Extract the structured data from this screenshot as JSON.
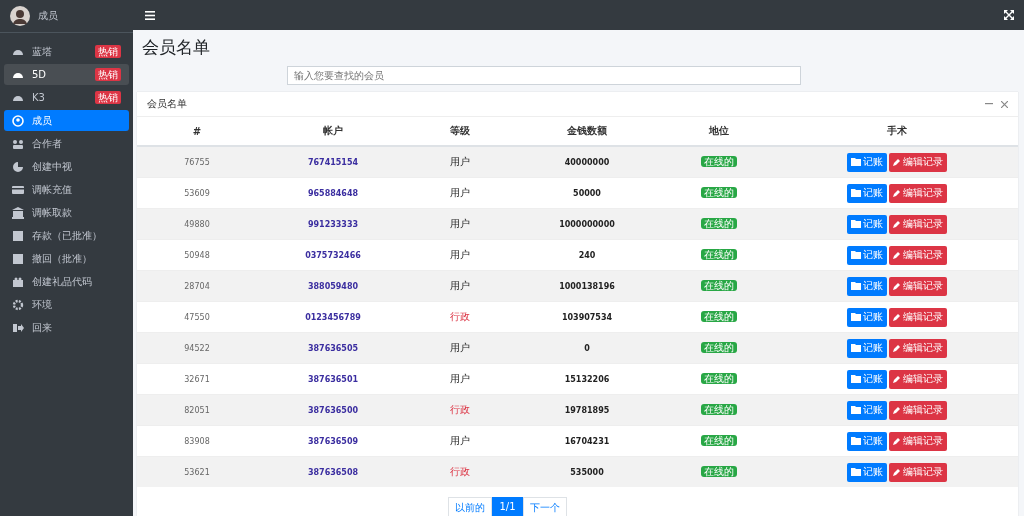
{
  "user": {
    "name": "成员"
  },
  "sidebar": {
    "items": [
      {
        "label": "蓝塔",
        "badge": "热销",
        "selected": false,
        "hover": false
      },
      {
        "label": "5D",
        "badge": "热销",
        "selected": false,
        "hover": true
      },
      {
        "label": "K3",
        "badge": "热销",
        "selected": false,
        "hover": false
      },
      {
        "label": "成员",
        "selected": true,
        "hover": false
      },
      {
        "label": "合作者",
        "selected": false,
        "hover": false
      },
      {
        "label": "创建中视",
        "selected": false,
        "hover": false
      },
      {
        "label": "调帐充值",
        "selected": false,
        "hover": false
      },
      {
        "label": "调帐取款",
        "selected": false,
        "hover": false
      },
      {
        "label": "存款（已批准）",
        "selected": false,
        "hover": false
      },
      {
        "label": "撤回（批准）",
        "selected": false,
        "hover": false
      },
      {
        "label": "创建礼品代码",
        "selected": false,
        "hover": false
      },
      {
        "label": "环境",
        "selected": false,
        "hover": false
      },
      {
        "label": "回来",
        "selected": false,
        "hover": false
      }
    ]
  },
  "page_title": "会员名单",
  "search": {
    "placeholder": "输入您要查找的会员"
  },
  "card": {
    "title": "会员名单",
    "columns": [
      "#",
      "帐户",
      "等级",
      "金钱数额",
      "地位",
      "手术"
    ],
    "rows": [
      {
        "id": "76755",
        "account": "767415154",
        "level": "用户",
        "kind": "user",
        "money": "40000000",
        "status": "在线的",
        "actions": [
          "记账",
          "编辑记录"
        ]
      },
      {
        "id": "53609",
        "account": "965884648",
        "level": "用户",
        "kind": "user",
        "money": "50000",
        "status": "在线的",
        "actions": [
          "记账",
          "编辑记录"
        ]
      },
      {
        "id": "49880",
        "account": "991233333",
        "level": "用户",
        "kind": "user",
        "money": "1000000000",
        "status": "在线的",
        "actions": [
          "记账",
          "编辑记录"
        ]
      },
      {
        "id": "50948",
        "account": "0375732466",
        "level": "用户",
        "kind": "user",
        "money": "240",
        "status": "在线的",
        "actions": [
          "记账",
          "编辑记录"
        ]
      },
      {
        "id": "28704",
        "account": "388059480",
        "level": "用户",
        "kind": "user",
        "money": "1000138196",
        "status": "在线的",
        "actions": [
          "记账",
          "编辑记录"
        ]
      },
      {
        "id": "47550",
        "account": "0123456789",
        "level": "行政",
        "kind": "admin",
        "money": "103907534",
        "status": "在线的",
        "actions": [
          "记账",
          "编辑记录"
        ]
      },
      {
        "id": "94522",
        "account": "387636505",
        "level": "用户",
        "kind": "user",
        "money": "0",
        "status": "在线的",
        "actions": [
          "记账",
          "编辑记录"
        ]
      },
      {
        "id": "32671",
        "account": "387636501",
        "level": "用户",
        "kind": "user",
        "money": "15132206",
        "status": "在线的",
        "actions": [
          "记账",
          "编辑记录"
        ]
      },
      {
        "id": "82051",
        "account": "387636500",
        "level": "行政",
        "kind": "admin",
        "money": "19781895",
        "status": "在线的",
        "actions": [
          "记账",
          "编辑记录"
        ]
      },
      {
        "id": "83908",
        "account": "387636509",
        "level": "用户",
        "kind": "user",
        "money": "16704231",
        "status": "在线的",
        "actions": [
          "记账",
          "编辑记录"
        ]
      },
      {
        "id": "53621",
        "account": "387636508",
        "level": "行政",
        "kind": "admin",
        "money": "535000",
        "status": "在线的",
        "actions": [
          "记账",
          "编辑记录"
        ]
      }
    ]
  },
  "pagination": [
    {
      "label": "以前的",
      "selected": false
    },
    {
      "label": "1/1",
      "selected": true
    },
    {
      "label": "下一个",
      "selected": false
    }
  ]
}
